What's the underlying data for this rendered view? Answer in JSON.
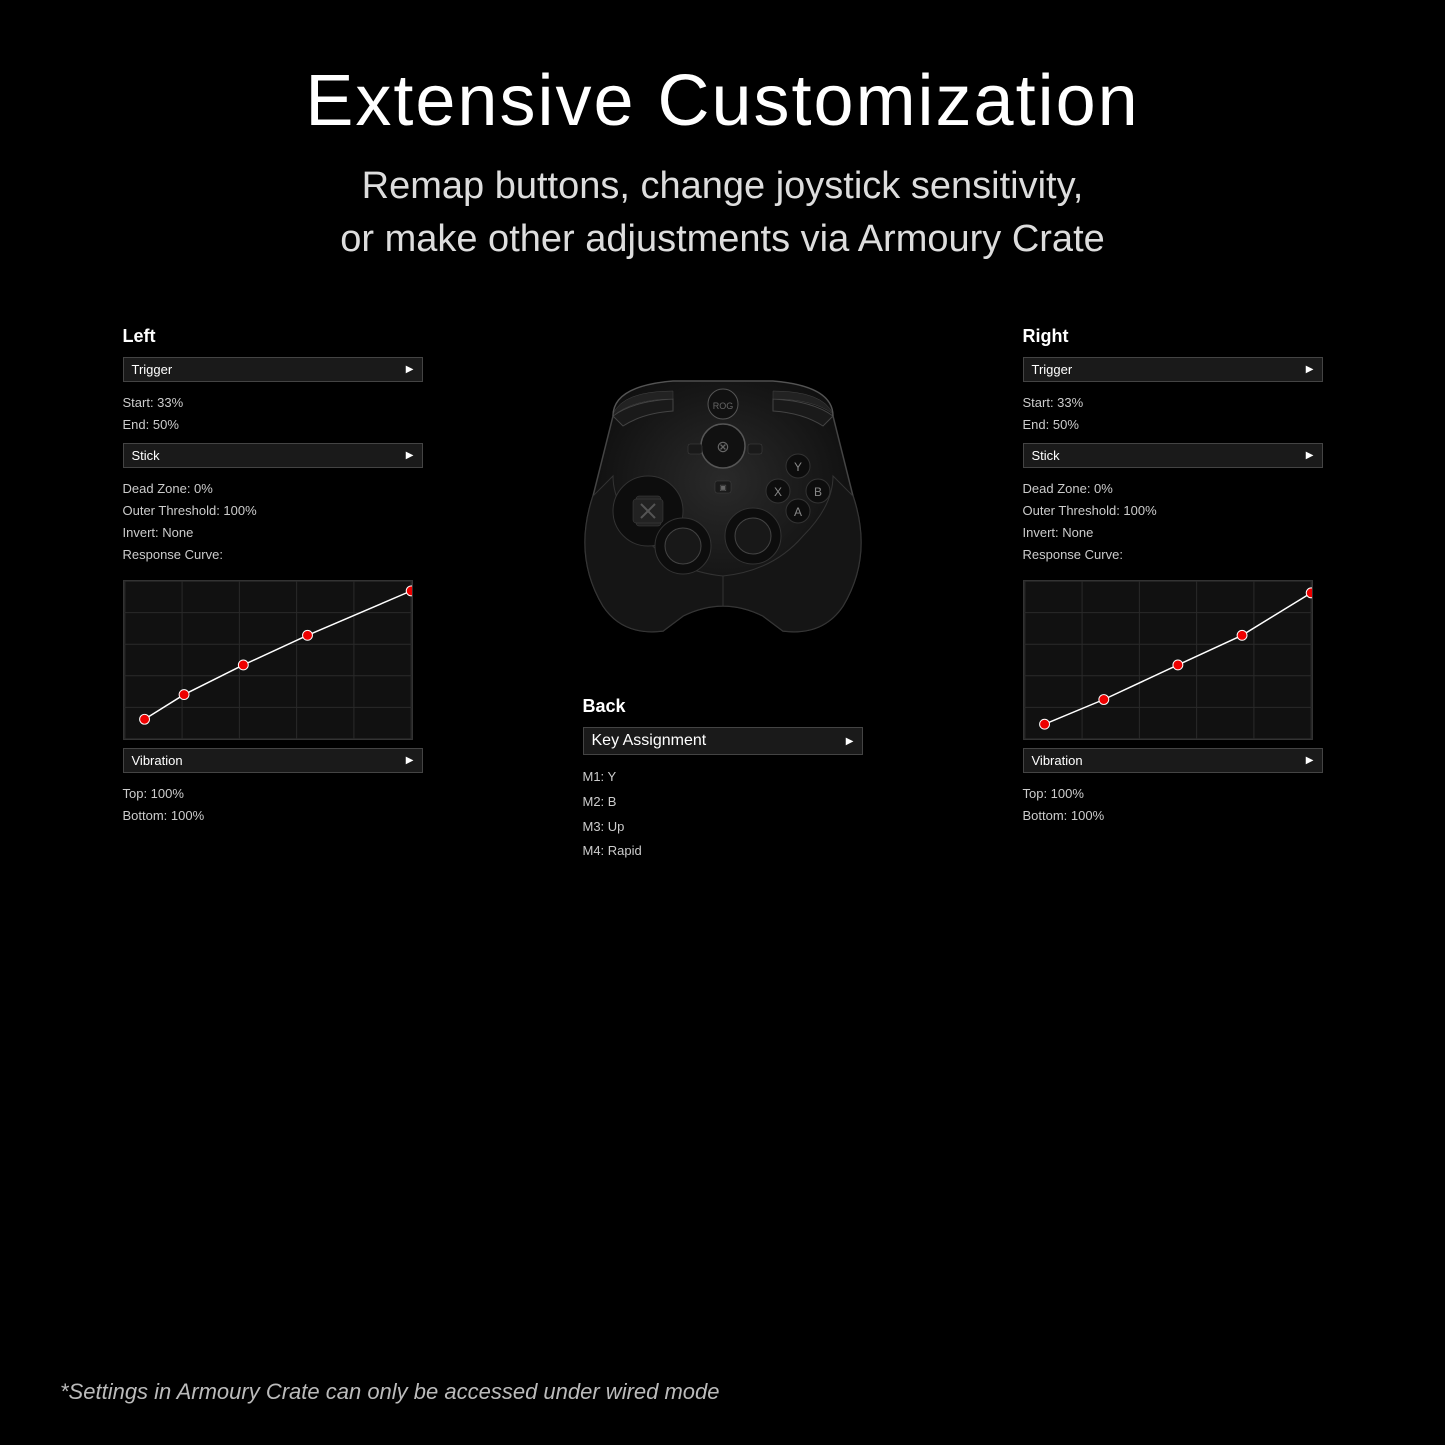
{
  "header": {
    "title": "Extensive Customization",
    "subtitle_line1": "Remap buttons, change joystick sensitivity,",
    "subtitle_line2": "or make other adjustments via Armoury Crate"
  },
  "left_panel": {
    "title": "Left",
    "trigger_label": "Trigger",
    "trigger_start": "Start:  33%",
    "trigger_end": "End:  50%",
    "stick_label": "Stick",
    "dead_zone": "Dead Zone:  0%",
    "outer_threshold": "Outer Threshold:  100%",
    "invert": "Invert:  None",
    "response_curve": "Response Curve:",
    "vibration_label": "Vibration",
    "top": "Top:  100%",
    "bottom": "Bottom:  100%"
  },
  "right_panel": {
    "title": "Right",
    "trigger_label": "Trigger",
    "trigger_start": "Start:  33%",
    "trigger_end": "End:  50%",
    "stick_label": "Stick",
    "dead_zone": "Dead Zone:  0%",
    "outer_threshold": "Outer Threshold:  100%",
    "invert": "Invert:  None",
    "response_curve": "Response Curve:",
    "vibration_label": "Vibration",
    "top": "Top:  100%",
    "bottom": "Bottom:  100%"
  },
  "back_panel": {
    "title": "Back",
    "key_assignment_label": "Key Assignment",
    "m1": "M1:  Y",
    "m2": "M2:  B",
    "m3": "M3:  Up",
    "m4": "M4:  Rapid"
  },
  "footer": {
    "note": "*Settings in Armoury Crate can only be accessed under wired mode"
  }
}
